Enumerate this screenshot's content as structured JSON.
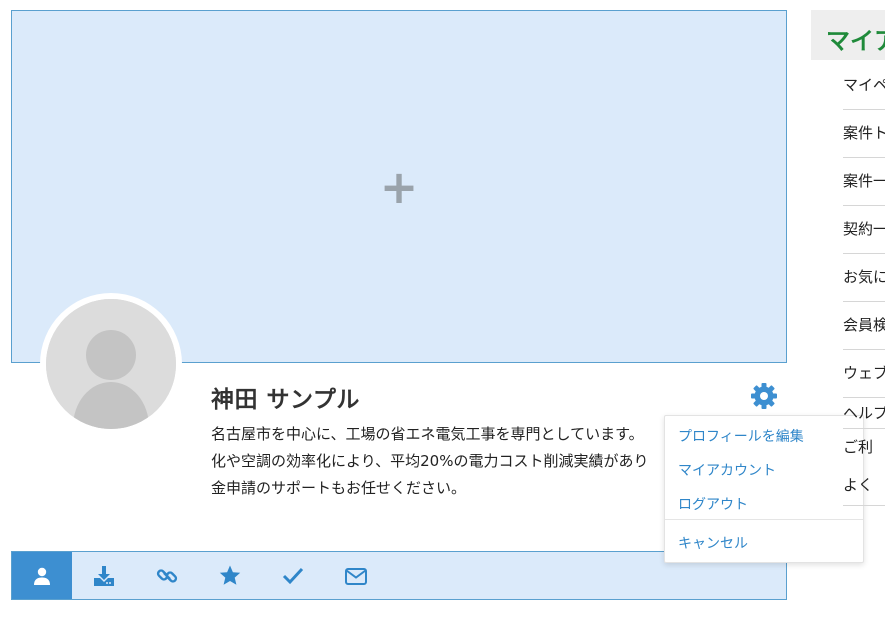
{
  "cover": {
    "add_icon": "plus-icon",
    "background": "#dbeafa"
  },
  "profile": {
    "name": "神田 サンプル",
    "bio": "名古屋市を中心に、工場の省エネ電気工事を専門としています。\n化や空調の効率化により、平均20%の電力コスト削減実績があり\n金申請のサポートもお任せください。"
  },
  "settings_menu": {
    "icon": "gear-icon",
    "items": [
      "プロフィールを編集",
      "マイアカウント",
      "ログアウト"
    ],
    "cancel": "キャンセル"
  },
  "tabs": [
    {
      "icon": "user-icon",
      "active": true
    },
    {
      "icon": "download-icon",
      "active": false
    },
    {
      "icon": "link-icon",
      "active": false
    },
    {
      "icon": "star-icon",
      "active": false
    },
    {
      "icon": "check-icon",
      "active": false
    },
    {
      "icon": "mail-icon",
      "active": false
    }
  ],
  "sidebar": {
    "title": "マイア",
    "items": [
      "マイペ",
      "案件ト",
      "案件一",
      "契約一",
      "お気に",
      "会員検",
      "ウェブ",
      "ヘルプ",
      "ご利",
      "よく"
    ]
  },
  "colors": {
    "accent": "#3d8fd1",
    "link": "#2f86c9",
    "sidebar_title": "#1f8a3a"
  }
}
